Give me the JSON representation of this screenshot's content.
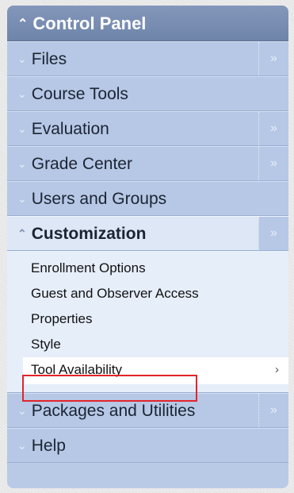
{
  "header": {
    "title": "Control Panel",
    "icon": "chevron-up-double-icon"
  },
  "menu": [
    {
      "label": "Files",
      "has_more": true
    },
    {
      "label": "Course Tools",
      "has_more": false
    },
    {
      "label": "Evaluation",
      "has_more": true
    },
    {
      "label": "Grade Center",
      "has_more": true
    },
    {
      "label": "Users and Groups",
      "has_more": false
    },
    {
      "label": "Customization",
      "has_more": true,
      "expanded": true
    },
    {
      "label": "Packages and Utilities",
      "has_more": true
    },
    {
      "label": "Help",
      "has_more": false
    }
  ],
  "submenu": [
    "Enrollment Options",
    "Guest and Observer Access",
    "Properties",
    "Style",
    "Tool Availability"
  ],
  "glyphs": {
    "collapse": "«",
    "more": "»",
    "arrow_right": "›"
  },
  "colors": {
    "highlight_border": "#e3242b",
    "header_bg": "#7589ad",
    "row_bg": "#b6c8e5"
  }
}
